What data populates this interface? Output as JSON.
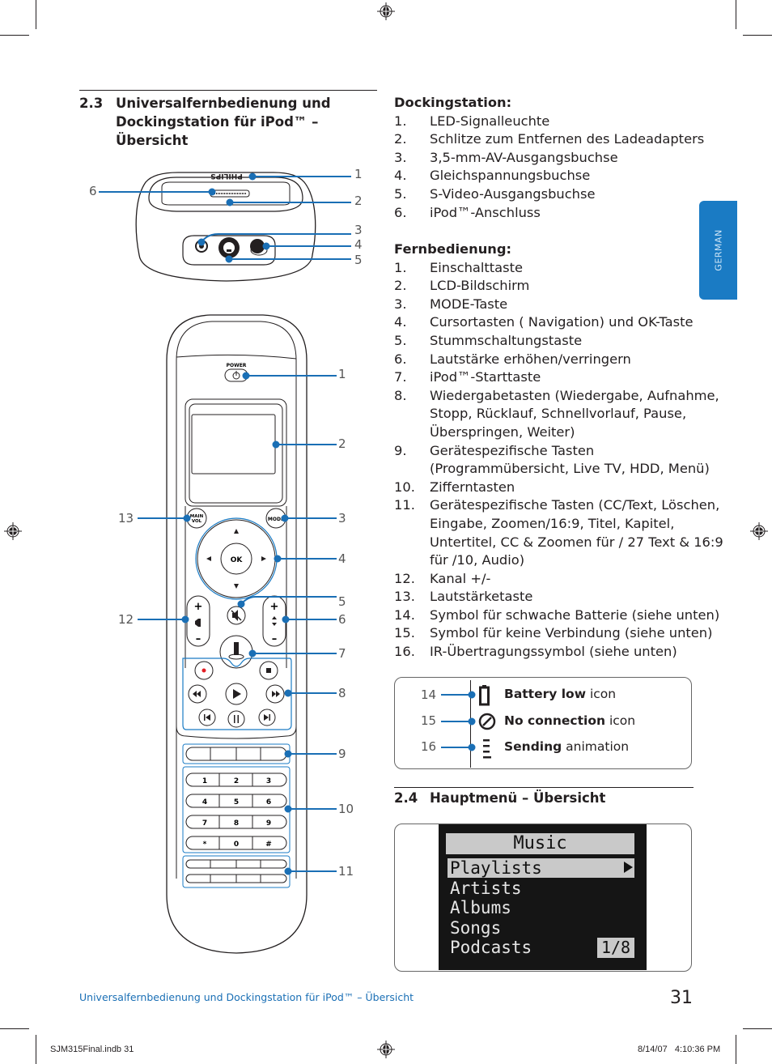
{
  "section_2_3": {
    "number": "2.3",
    "title": "Universalfernbedienung und Dockingstation für iPod™ – Übersicht"
  },
  "dock_figure": {
    "brand": "PHILIPS",
    "callouts": [
      "1",
      "2",
      "3",
      "4",
      "5",
      "6"
    ]
  },
  "remote_figure": {
    "power_label": "POWER",
    "main_vol_label": "MAIN VOL",
    "mode_label": "MODE",
    "ok_label": "OK",
    "keypad": [
      "1",
      "2",
      "3",
      "4",
      "5",
      "6",
      "7",
      "8",
      "9",
      "*",
      "0",
      "#"
    ],
    "callouts_right": [
      "1",
      "2",
      "3",
      "4",
      "5",
      "6",
      "7",
      "8",
      "9",
      "10",
      "11"
    ],
    "callouts_left": [
      "13",
      "12"
    ]
  },
  "dockingstation": {
    "heading": "Dockingstation:",
    "items": [
      {
        "n": "1.",
        "text": "LED-Signalleuchte"
      },
      {
        "n": "2.",
        "text": "Schlitze zum Entfernen des Ladeadapters"
      },
      {
        "n": "3.",
        "text": "3,5-mm-AV-Ausgangsbuchse"
      },
      {
        "n": "4.",
        "text": "Gleichspannungsbuchse"
      },
      {
        "n": "5.",
        "text": "S-Video-Ausgangsbuchse"
      },
      {
        "n": "6.",
        "text": "iPod™-Anschluss"
      }
    ]
  },
  "fernbedienung": {
    "heading": "Fernbedienung:",
    "items": [
      {
        "n": "1.",
        "text": "Einschalttaste"
      },
      {
        "n": "2.",
        "text": "LCD-Bildschirm"
      },
      {
        "n": "3.",
        "text": "MODE-Taste"
      },
      {
        "n": "4.",
        "text": "Cursortasten ( Navigation) und OK-Taste"
      },
      {
        "n": "5.",
        "text": "Stummschaltungstaste"
      },
      {
        "n": "6.",
        "text": "Lautstärke erhöhen/verringern"
      },
      {
        "n": "7.",
        "text": "iPod™-Starttaste"
      },
      {
        "n": "8.",
        "text": "Wiedergabetasten (Wiedergabe, Aufnahme, Stopp, Rücklauf, Schnellvorlauf, Pause, Überspringen, Weiter)"
      },
      {
        "n": "9.",
        "text": "Gerätespezifische Tasten (Programmübersicht, Live TV, HDD, Menü)"
      },
      {
        "n": "10.",
        "text": "Zifferntasten"
      },
      {
        "n": "11.",
        "text": "Gerätespezifische Tasten (CC/Text, Löschen, Eingabe, Zoomen/16:9, Titel, Kapitel, Untertitel, CC & Zoomen für / 27 Text & 16:9 für /10, Audio)"
      },
      {
        "n": "12.",
        "text": "Kanal +/-"
      },
      {
        "n": "13.",
        "text": "Lautstärketaste"
      },
      {
        "n": "14.",
        "text": "Symbol für schwache Batterie (siehe unten)"
      },
      {
        "n": "15.",
        "text": "Symbol für keine Verbindung (siehe unten)"
      },
      {
        "n": "16.",
        "text": "IR-Übertragungssymbol (siehe unten)"
      }
    ]
  },
  "status_icons": [
    {
      "n": "14",
      "icon": "battery-low-icon",
      "bold": "Battery low",
      "rest": " icon"
    },
    {
      "n": "15",
      "icon": "no-connection-icon",
      "bold": "No connection",
      "rest": " icon"
    },
    {
      "n": "16",
      "icon": "sending-animation-icon",
      "bold": "Sending",
      "rest": " animation"
    }
  ],
  "section_2_4": {
    "number": "2.4",
    "title": "Hauptmenü – Übersicht"
  },
  "main_menu_screen": {
    "title": "Music",
    "items": [
      "Playlists",
      "Artists",
      "Albums",
      "Songs",
      "Podcasts"
    ],
    "selected_index": 0,
    "page_indicator": "1/8"
  },
  "side_tab": "GERMAN",
  "footer": {
    "running_title": "Universalfernbedienung und Dockingstation für iPod™ – Übersicht",
    "page_number": "31"
  },
  "slug": {
    "file": "SJM315Final.indb   31",
    "timestamp": "8/14/07   4:10:36 PM"
  },
  "colors": {
    "accent": "#1a7bc4",
    "text": "#231f20",
    "record_dot": "#e31e24"
  }
}
